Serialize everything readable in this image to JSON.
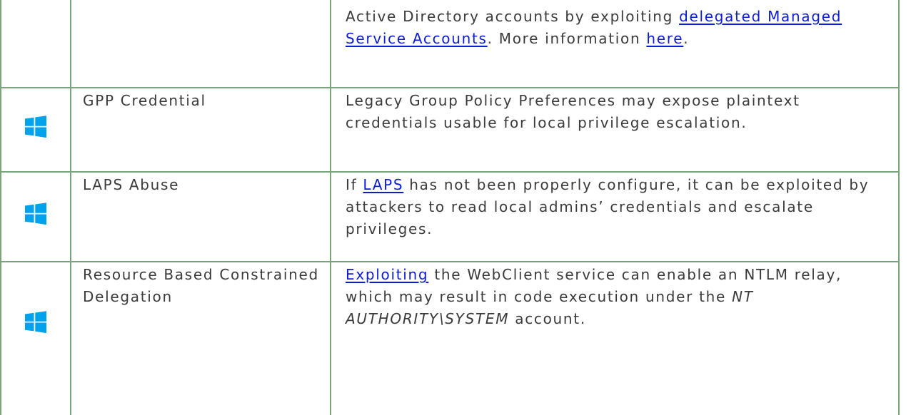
{
  "colors": {
    "border": "#7aa57a",
    "link": "#0b1bd6",
    "text": "#3a3a3a",
    "windows_icon": "#00a2ed"
  },
  "rows": [
    {
      "icon": "",
      "name": "",
      "desc": [
        {
          "type": "text",
          "text": "Active Directory accounts by exploiting "
        },
        {
          "type": "link",
          "text": "delegated Managed Service Accounts"
        },
        {
          "type": "text",
          "text": ". More information "
        },
        {
          "type": "link",
          "text": "here"
        },
        {
          "type": "text",
          "text": "."
        }
      ]
    },
    {
      "icon": "windows-icon",
      "name": "GPP Credential",
      "desc": [
        {
          "type": "text",
          "text": "Legacy Group Policy Preferences may expose plaintext credentials usable for local privilege escalation."
        }
      ]
    },
    {
      "icon": "windows-icon",
      "name": "LAPS Abuse",
      "desc": [
        {
          "type": "text",
          "text": "If "
        },
        {
          "type": "link",
          "text": "LAPS"
        },
        {
          "type": "text",
          "text": " has not been properly configure, it can be exploited by attackers to read local admins’ credentials and escalate privileges."
        }
      ]
    },
    {
      "icon": "windows-icon",
      "name": "Resource Based Constrained Delegation",
      "desc": [
        {
          "type": "link",
          "text": "Exploiting"
        },
        {
          "type": "text",
          "text": " the WebClient service can enable an NTLM relay, which may result in code execution under the "
        },
        {
          "type": "em",
          "text": "NT AUTHORITY\\SYSTEM"
        },
        {
          "type": "text",
          "text": " account."
        }
      ]
    }
  ]
}
